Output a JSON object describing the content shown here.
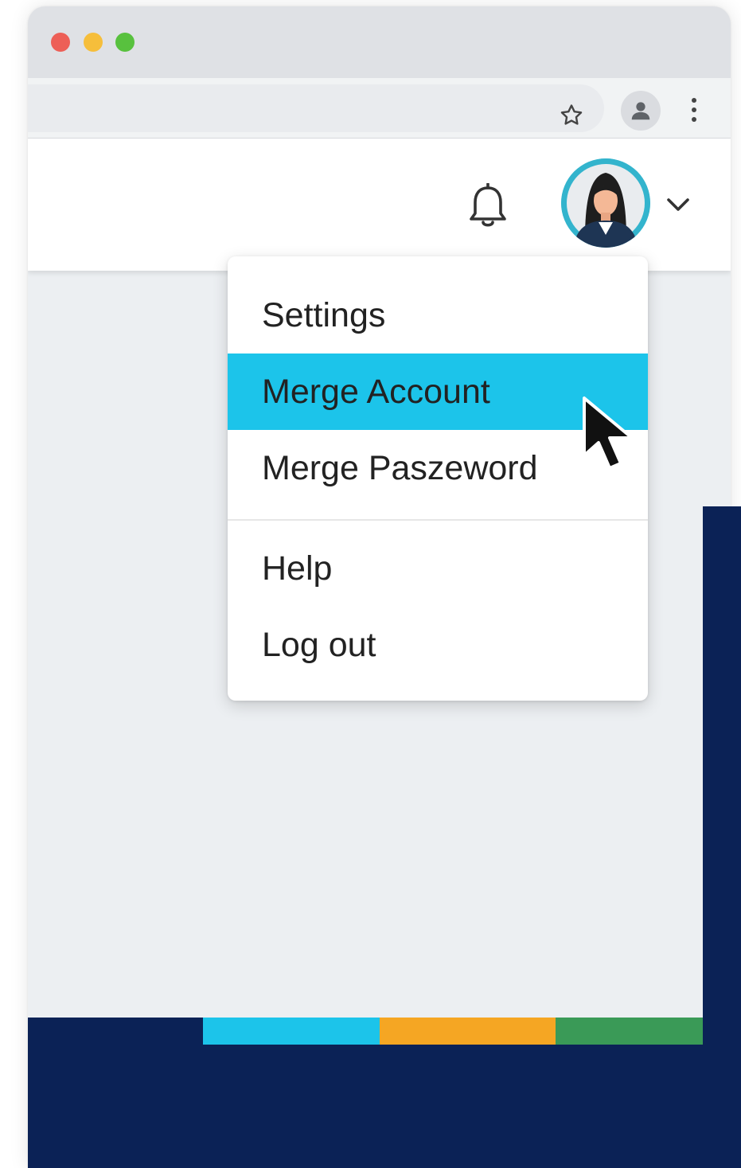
{
  "window": {
    "controls": [
      "close",
      "minimize",
      "maximize"
    ]
  },
  "toolbar": {
    "icons": [
      "star-icon",
      "profile-icon",
      "more-vert-icon"
    ]
  },
  "header": {
    "icons": [
      "bell-icon",
      "avatar",
      "chevron-down-icon"
    ]
  },
  "menu": {
    "items": [
      {
        "label": "Settings",
        "active": false
      },
      {
        "label": "Merge Account",
        "active": true
      },
      {
        "label": "Merge Paszeword",
        "active": false
      },
      {
        "label": "Help",
        "active": false
      },
      {
        "label": "Log out",
        "active": false
      }
    ]
  },
  "colors": {
    "highlight": "#1cc4ea",
    "navy": "#0b2256",
    "stripe_blue": "#1cc4ea",
    "stripe_orange": "#f5a623",
    "stripe_green": "#3a9a57"
  }
}
